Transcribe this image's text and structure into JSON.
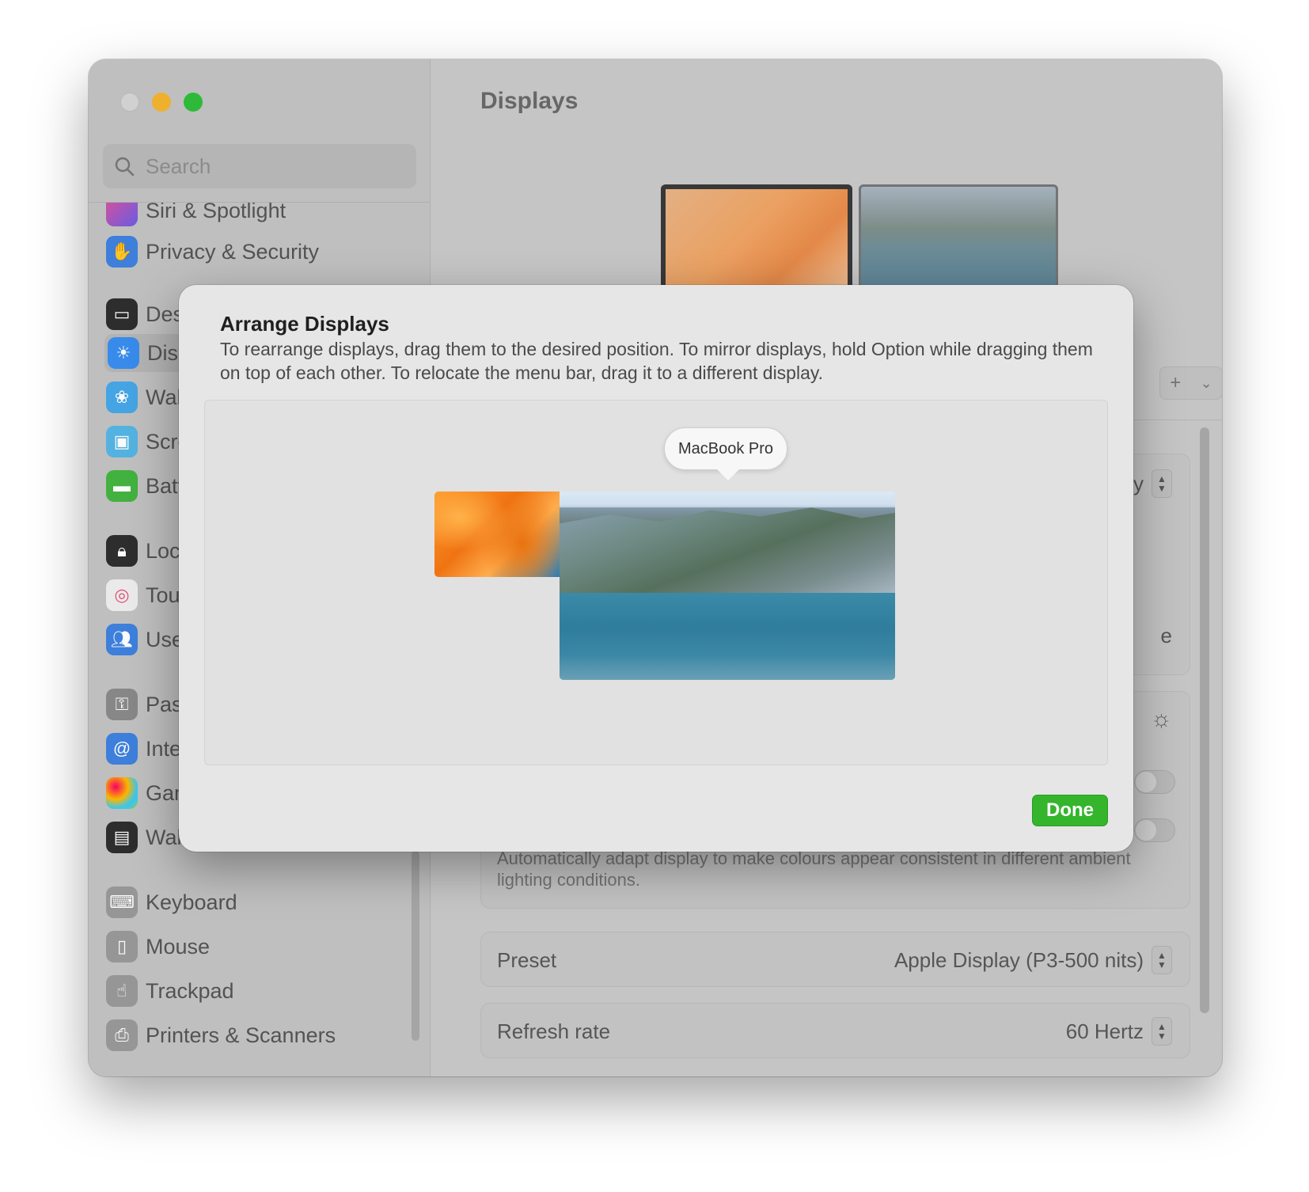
{
  "window": {
    "title": "Displays"
  },
  "sidebar": {
    "search_placeholder": "Search",
    "items": [
      {
        "label": "Siri & Spotlight",
        "icon": "siri-icon",
        "color": "#b15fd6"
      },
      {
        "label": "Privacy & Security",
        "icon": "hand-icon",
        "color": "#3f82e0"
      },
      {
        "label": "Desktop & Dock",
        "icon": "dock-icon",
        "color": "#2b2b2b"
      },
      {
        "label": "Displays",
        "icon": "sun-icon",
        "color": "#3a8ef0"
      },
      {
        "label": "Wallpaper",
        "icon": "flower-icon",
        "color": "#47a8e8"
      },
      {
        "label": "Screen Saver",
        "icon": "screen-saver-icon",
        "color": "#56b6e6"
      },
      {
        "label": "Battery",
        "icon": "battery-icon",
        "color": "#45b541"
      },
      {
        "label": "Lock Screen",
        "icon": "lock-icon",
        "color": "#2b2b2b"
      },
      {
        "label": "Touch ID & Password",
        "icon": "fingerprint-icon",
        "color": "#f2f2f2"
      },
      {
        "label": "Users & Groups",
        "icon": "users-icon",
        "color": "#3f82e0"
      },
      {
        "label": "Passwords",
        "icon": "key-icon",
        "color": "#8a8a8a"
      },
      {
        "label": "Internet Accounts",
        "icon": "at-icon",
        "color": "#3f82e0"
      },
      {
        "label": "Game Center",
        "icon": "game-center-icon",
        "color": "#e5e5e5"
      },
      {
        "label": "Wallet & Apple Pay",
        "icon": "wallet-icon",
        "color": "#2b2b2b"
      },
      {
        "label": "Keyboard",
        "icon": "keyboard-icon",
        "color": "#9a9a9a"
      },
      {
        "label": "Mouse",
        "icon": "mouse-icon",
        "color": "#9a9a9a"
      },
      {
        "label": "Trackpad",
        "icon": "trackpad-icon",
        "color": "#9a9a9a"
      },
      {
        "label": "Printers & Scanners",
        "icon": "printer-icon",
        "color": "#9a9a9a"
      }
    ]
  },
  "main": {
    "title": "Displays",
    "add_button": "+",
    "ambient_description": "Automatically adapt display to make colours appear consistent in different ambient lighting conditions.",
    "preset": {
      "label": "Preset",
      "value": "Apple Display (P3-500 nits)"
    },
    "refresh_rate": {
      "label": "Refresh rate",
      "value": "60 Hertz"
    },
    "partial_y": "y",
    "partial_e": "e"
  },
  "sheet": {
    "title": "Arrange Displays",
    "description": "To rearrange displays, drag them to the desired position. To mirror displays, hold Option while dragging them on top of each other. To relocate the menu bar, drag it to a different display.",
    "tooltip": "MacBook Pro",
    "done_label": "Done",
    "done_color": "#34b52c"
  }
}
